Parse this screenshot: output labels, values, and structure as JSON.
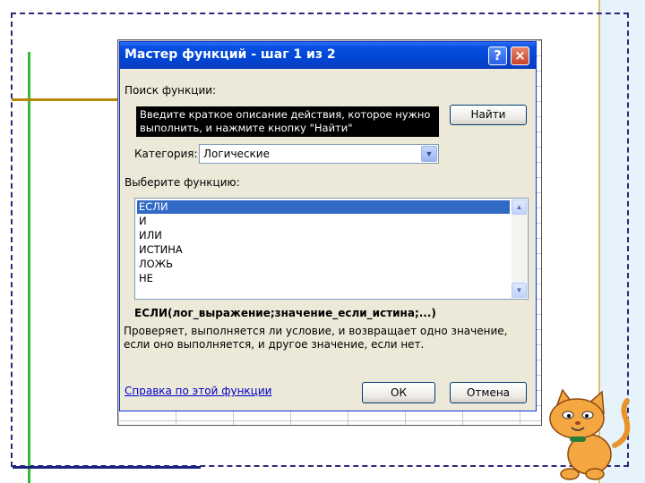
{
  "dialog": {
    "title": "Мастер функций - шаг 1 из 2",
    "help_button": "?",
    "close_button": "×",
    "search_label": "Поиск функции:",
    "search_text": "Введите краткое описание действия, которое нужно выполнить, и нажмите кнопку \"Найти\"",
    "find_button": "Найти",
    "category_label": "Категория:",
    "category_value": "Логические",
    "choose_label": "Выберите функцию:",
    "functions": [
      "ЕСЛИ",
      "И",
      "ИЛИ",
      "ИСТИНА",
      "ЛОЖЬ",
      "НЕ"
    ],
    "selected_function": "ЕСЛИ",
    "signature": "ЕСЛИ(лог_выражение;значение_если_истина;...)",
    "description": "Проверяет, выполняется ли условие, и возвращает одно значение, если оно выполняется, и другое значение, если нет.",
    "help_link": "Справка по этой функции",
    "ok_button": "ОК",
    "cancel_button": "Отмена"
  },
  "colors": {
    "titlebar": "#0046d5",
    "dialog_bg": "#ece9d8",
    "selection": "#316ac5",
    "link": "#0000cc"
  }
}
